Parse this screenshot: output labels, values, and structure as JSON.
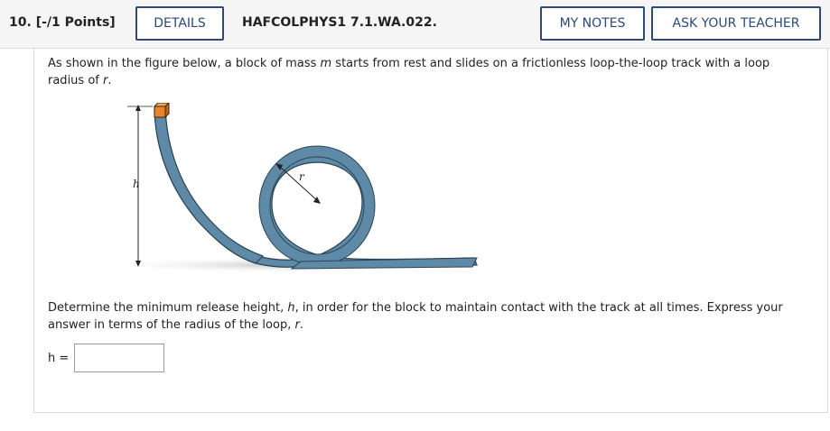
{
  "header": {
    "question_number": "10.",
    "points": "[-/1 Points]",
    "details_label": "DETAILS",
    "question_id": "HAFCOLPHYS1 7.1.WA.022.",
    "my_notes_label": "MY NOTES",
    "ask_teacher_label": "ASK YOUR TEACHER"
  },
  "problem": {
    "intro_1": "As shown in the figure below, a block of mass ",
    "intro_var_m": "m",
    "intro_2": " starts from rest and slides on a frictionless loop-the-loop track with a loop radius of ",
    "intro_var_r": "r",
    "intro_3": ".",
    "figure": {
      "height_label": "h",
      "radius_label": "r"
    },
    "question_1": "Determine the minimum release height, ",
    "question_var_h": "h",
    "question_2": ", in order for the block to maintain contact with the track at all times. Express your answer in terms of the radius of the loop, ",
    "question_var_r": "r",
    "question_3": "."
  },
  "answer": {
    "label": "h =",
    "value": ""
  },
  "colors": {
    "button_border": "#2c4a78",
    "track": "#5e8aa8",
    "block": "#e8862c"
  }
}
